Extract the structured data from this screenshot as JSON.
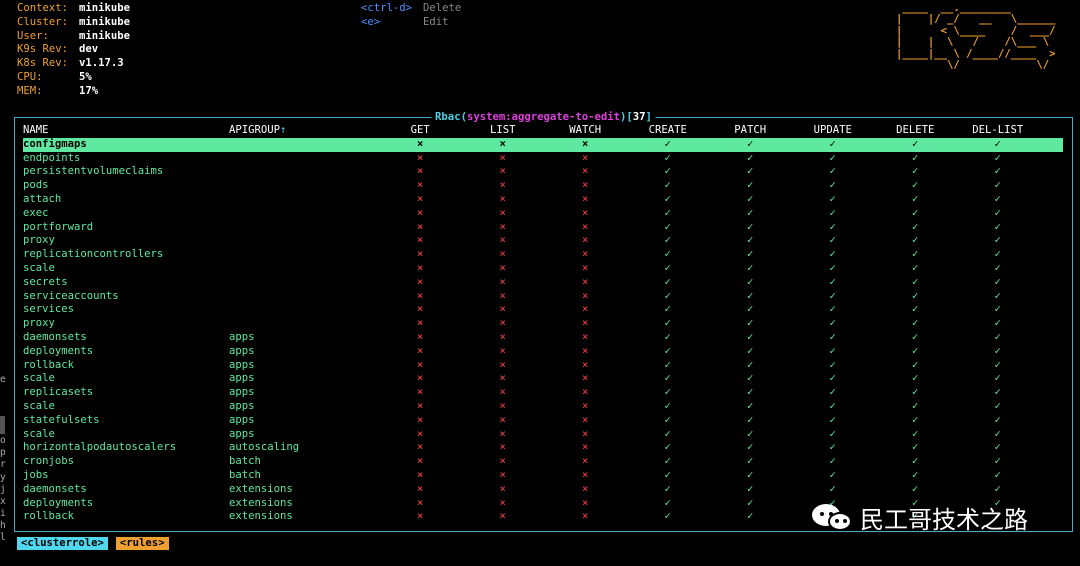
{
  "info": [
    {
      "label": "Context:",
      "value": "minikube"
    },
    {
      "label": "Cluster:",
      "value": "minikube"
    },
    {
      "label": "User:",
      "value": "minikube"
    },
    {
      "label": "K9s Rev:",
      "value": "dev"
    },
    {
      "label": "K8s Rev:",
      "value": "v1.17.3"
    },
    {
      "label": "CPU:",
      "value": "5%"
    },
    {
      "label": "MEM:",
      "value": "17%"
    }
  ],
  "keys": [
    {
      "key": "<ctrl-d>",
      "desc": "Delete"
    },
    {
      "key": "<e>",
      "desc": "Edit"
    }
  ],
  "logo": " ____  __.________\n|    |/ _/   __   \\______\n|      < \\____    /  ___/\n|    |  \\   /    /\\___ \\\n|____|__ \\ /____//____  >\n        \\/            \\/",
  "title": {
    "prefix": "Rbac(",
    "name": "system:aggregate-to-edit",
    "mid": ")[",
    "count": "37",
    "suffix": "]"
  },
  "columns": {
    "name": "NAME",
    "apigroup": "APIGROUP",
    "sort_arrow": "↑",
    "verbs": [
      "GET",
      "LIST",
      "WATCH",
      "CREATE",
      "PATCH",
      "UPDATE",
      "DELETE",
      "DEL-LIST"
    ]
  },
  "rows": [
    {
      "name": "configmaps",
      "group": ""
    },
    {
      "name": "endpoints",
      "group": ""
    },
    {
      "name": "persistentvolumeclaims",
      "group": ""
    },
    {
      "name": "pods",
      "group": ""
    },
    {
      "name": "attach",
      "group": ""
    },
    {
      "name": "exec",
      "group": ""
    },
    {
      "name": "portforward",
      "group": ""
    },
    {
      "name": "proxy",
      "group": ""
    },
    {
      "name": "replicationcontrollers",
      "group": ""
    },
    {
      "name": "scale",
      "group": ""
    },
    {
      "name": "secrets",
      "group": ""
    },
    {
      "name": "serviceaccounts",
      "group": ""
    },
    {
      "name": "services",
      "group": ""
    },
    {
      "name": "proxy",
      "group": ""
    },
    {
      "name": "daemonsets",
      "group": "apps"
    },
    {
      "name": "deployments",
      "group": "apps"
    },
    {
      "name": "rollback",
      "group": "apps"
    },
    {
      "name": "scale",
      "group": "apps"
    },
    {
      "name": "replicasets",
      "group": "apps"
    },
    {
      "name": "scale",
      "group": "apps"
    },
    {
      "name": "statefulsets",
      "group": "apps"
    },
    {
      "name": "scale",
      "group": "apps"
    },
    {
      "name": "horizontalpodautoscalers",
      "group": "autoscaling"
    },
    {
      "name": "cronjobs",
      "group": "batch"
    },
    {
      "name": "jobs",
      "group": "batch"
    },
    {
      "name": "daemonsets",
      "group": "extensions"
    },
    {
      "name": "deployments",
      "group": "extensions"
    },
    {
      "name": "rollback",
      "group": "extensions"
    }
  ],
  "permissions": [
    "×",
    "×",
    "×",
    "✓",
    "✓",
    "✓",
    "✓",
    "✓"
  ],
  "crumbs": [
    "<clusterrole>",
    "<rules>"
  ],
  "left_chars": [
    "e",
    "",
    "",
    "",
    "",
    "o",
    "p",
    "r",
    "y",
    "j",
    "x",
    "i",
    "h",
    "l"
  ],
  "watermark": "民工哥技术之路"
}
